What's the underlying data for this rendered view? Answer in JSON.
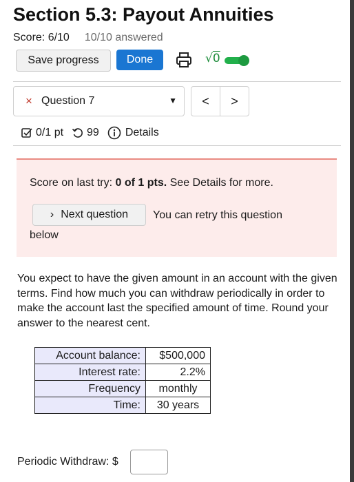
{
  "header": {
    "title": "Section 5.3: Payout Annuities",
    "score": "Score: 6/10",
    "answered": "10/10 answered"
  },
  "toolbar": {
    "save_label": "Save progress",
    "done_label": "Done",
    "print_icon": "printer-icon",
    "math_icon": "sqrt-icon",
    "math_symbol": "√",
    "math_radicand": "0",
    "toggle_state": "on"
  },
  "question_nav": {
    "status_icon": "×",
    "question_label": "Question 7",
    "prev_label": "<",
    "next_label": ">"
  },
  "meta": {
    "points": "0/1 pt",
    "attempts": "99",
    "details_label": "Details"
  },
  "alert": {
    "prefix": "Score on last try: ",
    "score": "0 of 1 pts.",
    "suffix": " See Details for more.",
    "next_button_label": "Next question",
    "retry_line1": "You can retry this question",
    "retry_line2": "below"
  },
  "problem": {
    "text": "You expect to have the given amount in an account with the given terms. Find how much you can withdraw periodically in order to make the account last the specified amount of time. Round your answer to the nearest cent."
  },
  "table": {
    "rows": [
      {
        "label": "Account balance:",
        "value": "$500,000"
      },
      {
        "label": "Interest rate:",
        "value": "2.2%"
      },
      {
        "label": "Frequency",
        "value": "monthly"
      },
      {
        "label": "Time:",
        "value": "30 years"
      }
    ]
  },
  "answer": {
    "label": "Periodic Withdraw: $",
    "value": ""
  },
  "colors": {
    "accent": "#1a76d2",
    "toggle": "#22b04b",
    "alert_bg": "#fdeceb",
    "error": "#c0392b"
  }
}
